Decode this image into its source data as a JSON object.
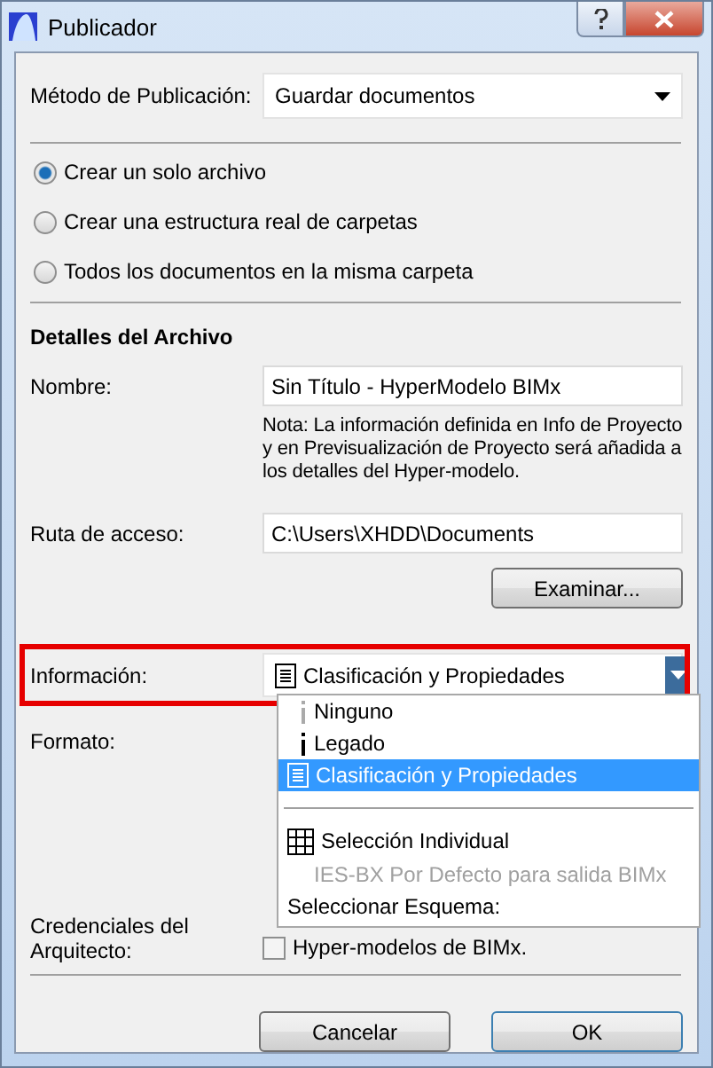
{
  "window": {
    "title": "Publicador"
  },
  "method": {
    "label": "Método de Publicación:",
    "value": "Guardar documentos"
  },
  "radios": [
    {
      "label": "Crear un solo archivo",
      "selected": true
    },
    {
      "label": "Crear una estructura real de carpetas",
      "selected": false
    },
    {
      "label": "Todos los documentos en la misma carpeta",
      "selected": false
    }
  ],
  "details": {
    "heading": "Detalles del Archivo",
    "name_label": "Nombre:",
    "name_value": "Sin Título - HyperModelo BIMx",
    "note": "Nota: La información definida en Info de Proyecto y en Previsualización de Proyecto será añadida a los detalles del Hyper-modelo.",
    "path_label": "Ruta de acceso:",
    "path_value": "C:\\Users\\XHDD\\Documents",
    "browse_button": "Examinar..."
  },
  "information": {
    "label": "Información:",
    "value": "Clasificación y Propiedades",
    "highlighted": true,
    "expanded": true,
    "options": [
      {
        "kind": "info",
        "label": "Ninguno",
        "selected": false,
        "disabled": false
      },
      {
        "kind": "info",
        "label": "Legado",
        "selected": false,
        "disabled": false
      },
      {
        "kind": "document",
        "label": "Clasificación y Propiedades",
        "selected": true,
        "disabled": false
      },
      {
        "kind": "separator"
      },
      {
        "kind": "grid",
        "label": "Selección Individual",
        "selected": false,
        "disabled": false
      },
      {
        "kind": "plain",
        "label": "IES-BX Por Defecto para salida BIMx",
        "selected": false,
        "disabled": true
      },
      {
        "kind": "header",
        "label": "Seleccionar Esquema:",
        "selected": false,
        "disabled": false
      }
    ]
  },
  "format": {
    "label": "Formato:"
  },
  "credentials": {
    "label": "Credenciales del Arquitecto:",
    "checkbox_text": "Hyper-modelos de BIMx.",
    "checked": false
  },
  "buttons": [
    {
      "label": "Cancelar",
      "default": false
    },
    {
      "label": "OK",
      "default": true
    }
  ]
}
